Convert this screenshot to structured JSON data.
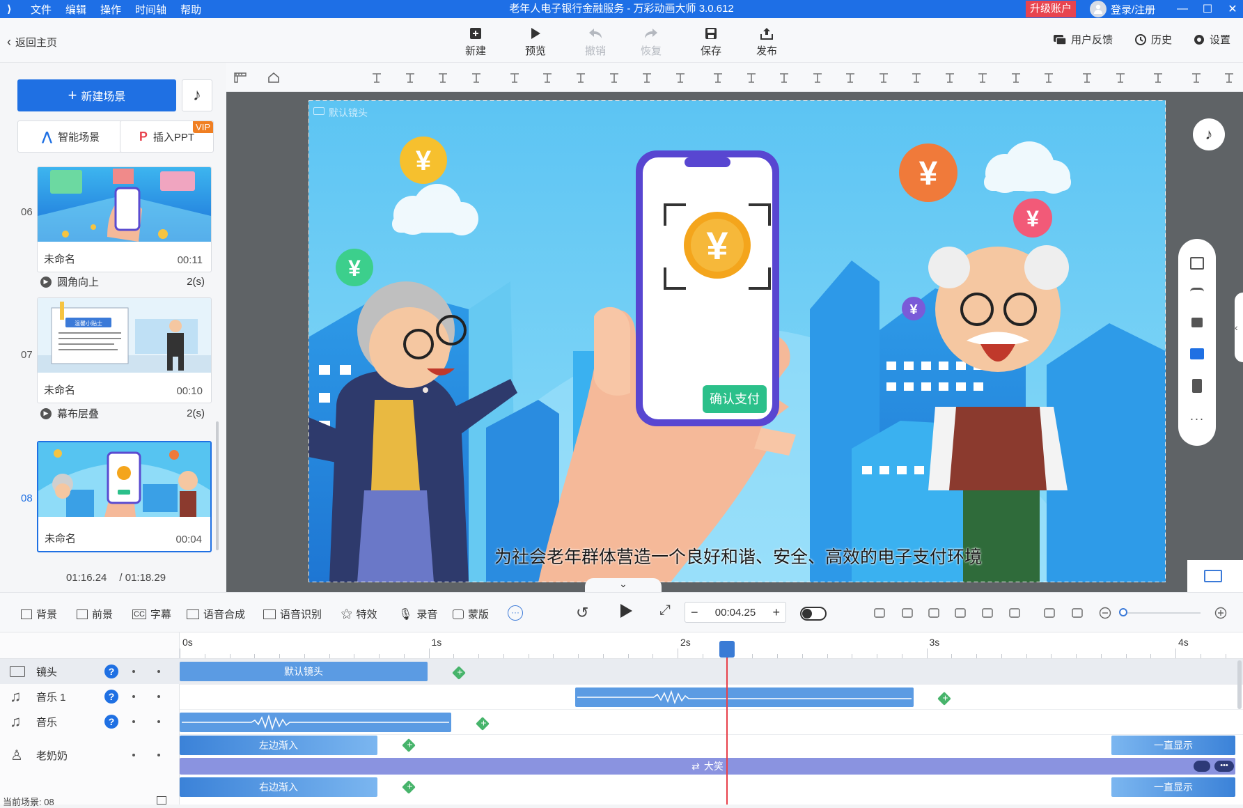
{
  "titlebar": {
    "menu": [
      "文件",
      "编辑",
      "操作",
      "时间轴",
      "帮助"
    ],
    "title": "老年人电子银行金融服务 - 万彩动画大师 3.0.612",
    "upgrade": "升级账户",
    "login": "登录/注册"
  },
  "toolbar": {
    "back": "返回主页",
    "new": "新建",
    "preview": "预览",
    "undo": "撤销",
    "redo": "恢复",
    "save": "保存",
    "publish": "发布",
    "feedback": "用户反馈",
    "history": "历史",
    "settings": "设置"
  },
  "left": {
    "new_scene": "新建场景",
    "smart_scene": "智能场景",
    "insert_ppt": "插入PPT",
    "vip": "VIP",
    "scenes": [
      {
        "num": "06",
        "name": "未命名",
        "time": "00:11"
      },
      {
        "num": "07",
        "name": "未命名",
        "time": "00:10"
      },
      {
        "num": "08",
        "name": "未命名",
        "time": "00:04"
      }
    ],
    "transitions": [
      {
        "name": "圆角向上",
        "dur": "2(s)"
      },
      {
        "name": "幕布层叠",
        "dur": "2(s)"
      }
    ],
    "current_time": "01:16.24",
    "total_time": "/ 01:18.29"
  },
  "canvas": {
    "camera_label": "默认镜头",
    "confirm_btn": "确认支付",
    "subtitle": "为社会老年群体营造一个良好和谐、安全、高效的电子支付环境",
    "thumb_text": "温馨小贴士"
  },
  "bottom": {
    "background": "背景",
    "foreground": "前景",
    "caption": "字幕",
    "tts": "语音合成",
    "asr": "语音识别",
    "effects": "特效",
    "record": "录音",
    "mask": "蒙版",
    "time": "00:04.25"
  },
  "timeline": {
    "ruler": [
      "0s",
      "1s",
      "2s",
      "3s",
      "4s"
    ],
    "tracks": [
      {
        "name": "镜头"
      },
      {
        "name": "音乐 1"
      },
      {
        "name": "音乐"
      },
      {
        "name": "老奶奶"
      }
    ],
    "clips": {
      "camera": "默认镜头",
      "enter_left": "左边渐入",
      "always_show": "一直显示",
      "laugh": "大笑",
      "enter_right": "右边渐入",
      "always_show2": "一直显示"
    },
    "current_scene": "当前场景: 08"
  },
  "colors": {
    "brand": "#1f70e3",
    "titlebar": "#1e6fe6",
    "playhead": "#e8404a",
    "clip_blue": "#5b9be3",
    "clip_purple": "#8a93e0"
  }
}
